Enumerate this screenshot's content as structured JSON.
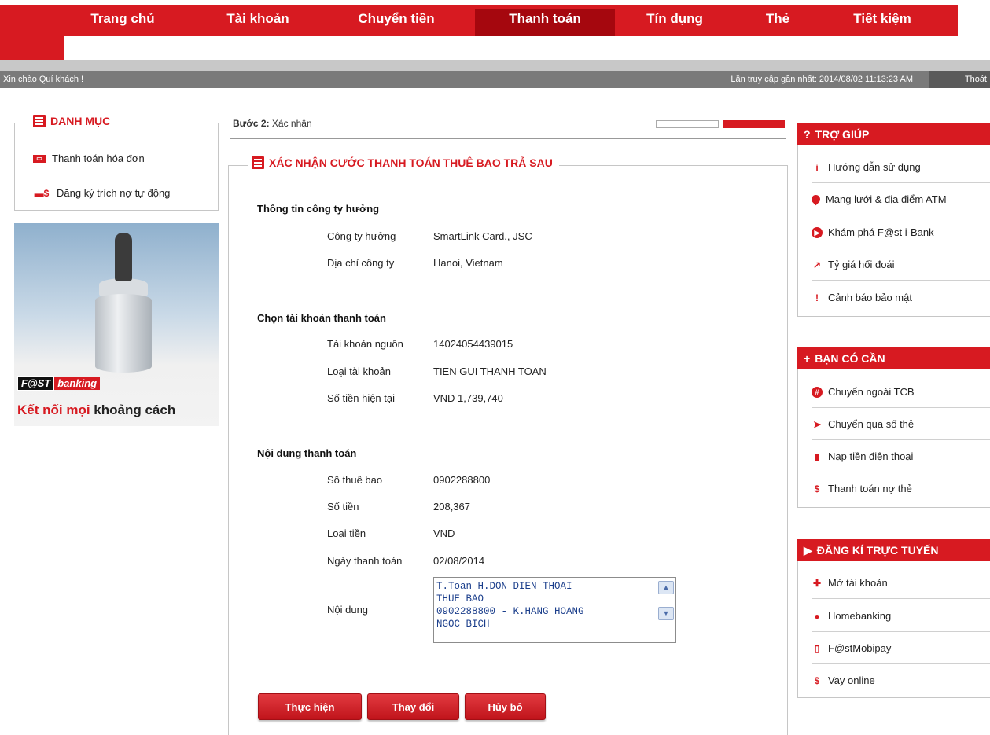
{
  "nav": {
    "items": [
      "Trang chủ",
      "Tài khoản",
      "Chuyển tiền",
      "Thanh toán",
      "Tín dụng",
      "Thẻ",
      "Tiết kiệm"
    ],
    "active": "Thanh toán"
  },
  "status": {
    "greeting": "Xin chào Quí khách !",
    "last_visit": "Lần truy cập gần nhất: 2014/08/02 11:13:23 AM",
    "logout": "Thoát"
  },
  "left": {
    "menu_title": "DANH MỤC",
    "items": [
      "Thanh toán hóa đơn",
      "Đăng ký trích nợ tự động"
    ],
    "banner": {
      "brand1": "F@ST",
      "brand2": "banking",
      "slogan_a": "Kết nối ",
      "slogan_b": "mọi",
      "slogan_c": " khoảng cách"
    }
  },
  "step": {
    "label": "Bước 2:",
    "text": " Xác nhận"
  },
  "main": {
    "title": "XÁC NHẬN CƯỚC THANH TOÁN THUÊ BAO TRẢ SAU",
    "section1": {
      "title": "Thông tin công ty hưởng",
      "rows": [
        {
          "label": "Công ty hưởng",
          "value": "SmartLink Card., JSC"
        },
        {
          "label": "Địa chỉ công ty",
          "value": "Hanoi, Vietnam"
        }
      ]
    },
    "section2": {
      "title": "Chọn tài khoản thanh toán",
      "rows": [
        {
          "label": "Tài khoản nguồn",
          "value": "14024054439015"
        },
        {
          "label": "Loại tài khoản",
          "value": "TIEN GUI THANH TOAN"
        },
        {
          "label": "Số tiền hiện tại",
          "value": "VND 1,739,740"
        }
      ]
    },
    "section3": {
      "title": "Nội dung thanh toán",
      "rows": [
        {
          "label": "Số thuê bao",
          "value": "0902288800"
        },
        {
          "label": "Số tiền",
          "value": "208,367"
        },
        {
          "label": "Loại tiền",
          "value": "VND"
        },
        {
          "label": "Ngày thanh toán",
          "value": "02/08/2014"
        }
      ],
      "note_label": "Nội dung",
      "note_value": "T.Toan H.DON DIEN THOAI -\nTHUE BAO\n0902288800 - K.HANG HOANG\nNGOC BICH"
    },
    "buttons": {
      "submit": "Thực hiện",
      "change": "Thay đổi",
      "cancel": "Hủy bỏ"
    }
  },
  "right": {
    "help": {
      "title": "TRỢ GIÚP",
      "items": [
        "Hướng dẫn sử dụng",
        "Mạng lưới & địa điểm ATM",
        "Khám phá F@st i-Bank",
        "Tỷ giá hối đoái",
        "Cảnh báo bảo mật"
      ]
    },
    "need": {
      "title": "BẠN CÓ CẦN",
      "items": [
        "Chuyển ngoài TCB",
        "Chuyển qua số thẻ",
        "Nạp tiền điện thoại",
        "Thanh toán nợ thẻ"
      ]
    },
    "register": {
      "title": "ĐĂNG KÍ TRỰC TUYẾN",
      "items": [
        "Mở tài khoản",
        "Homebanking",
        "F@stMobipay",
        "Vay online"
      ]
    }
  },
  "colors": {
    "brand_red": "#d71a21",
    "active_tab": "#a5070e",
    "status_bar": "#7a7a7a"
  }
}
